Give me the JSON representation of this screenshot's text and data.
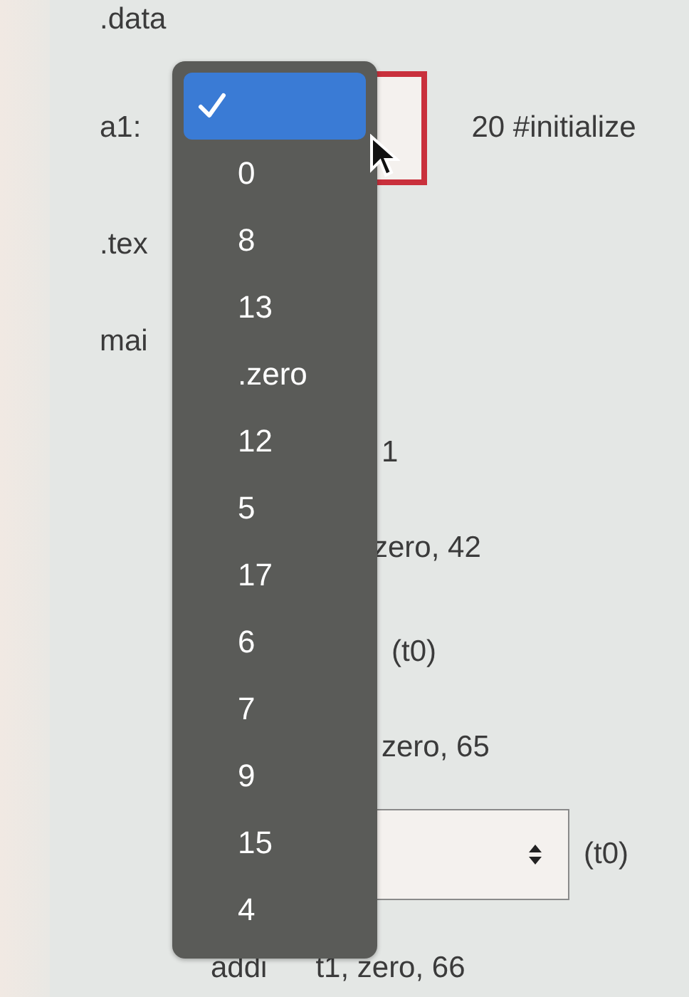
{
  "lines": [
    {
      "kind": "directive",
      "text": ".data"
    },
    {
      "kind": "select_line",
      "label": "a1:",
      "select": {
        "focused": true
      },
      "after": "20 #initialize"
    },
    {
      "kind": "directive",
      "text": ".tex"
    },
    {
      "kind": "directive",
      "text": "mai"
    },
    {
      "kind": "operand",
      "text": "1"
    },
    {
      "kind": "operand",
      "text": "zero, 42"
    },
    {
      "kind": "operand",
      "text": "(t0)"
    },
    {
      "kind": "operand",
      "text": "zero, 65"
    },
    {
      "kind": "select_line",
      "select": {
        "focused": false
      },
      "after": "(t0)"
    },
    {
      "kind": "instruction",
      "op": "addi",
      "text": "t1, zero, 66"
    }
  ],
  "dropdown_menu": {
    "options": [
      {
        "selected": true
      },
      {
        "label": "0",
        "selected": false
      },
      {
        "label": "8",
        "selected": false
      },
      {
        "label": "13",
        "selected": false
      },
      {
        "label": ".zero",
        "selected": false
      },
      {
        "label": "12",
        "selected": false
      },
      {
        "label": "5",
        "selected": false
      },
      {
        "label": "17",
        "selected": false
      },
      {
        "label": "6",
        "selected": false
      },
      {
        "label": "7",
        "selected": false
      },
      {
        "label": "9",
        "selected": false
      },
      {
        "label": "15",
        "selected": false
      },
      {
        "label": "4",
        "selected": false
      }
    ]
  }
}
